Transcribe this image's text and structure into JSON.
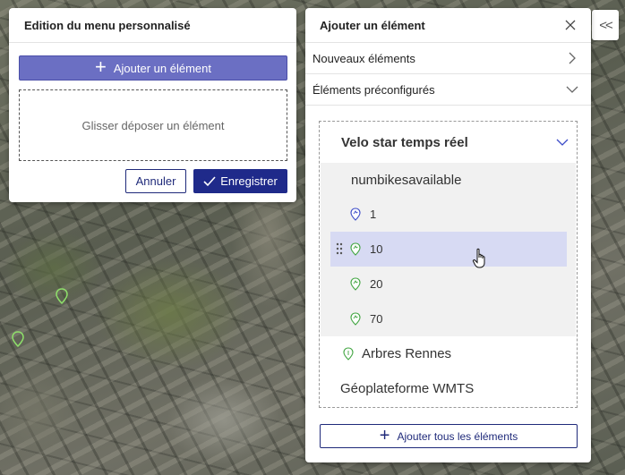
{
  "colors": {
    "accent": "#1f2a8a",
    "add_button": "#6b6fc3",
    "hover_row": "#d7daf3",
    "pin_blue": "#3b4bc8",
    "pin_green": "#3fa43f"
  },
  "collapse_button": {
    "icon": "double-chevron-left-icon",
    "label": "<<"
  },
  "edit_panel": {
    "title": "Edition du menu personnalisé",
    "add_button": "Ajouter un élément",
    "drop_zone": "Glisser déposer un élément",
    "cancel": "Annuler",
    "save": "Enregistrer"
  },
  "add_panel": {
    "title": "Ajouter un élément",
    "sections": {
      "new_elements": "Nouveaux éléments",
      "preconfigured": "Éléments préconfigurés"
    },
    "tree": {
      "group": "Velo star temps réel",
      "subgroup": "numbikesavailable",
      "items": [
        {
          "label": "1",
          "icon": "map-pin-blue-icon"
        },
        {
          "label": "10",
          "icon": "map-pin-green-icon"
        },
        {
          "label": "20",
          "icon": "map-pin-green-icon"
        },
        {
          "label": "70",
          "icon": "map-pin-green-icon"
        }
      ],
      "layer_trees": "Arbres Rennes",
      "layer_wmts": "Géoplateforme WMTS"
    },
    "add_all": "Ajouter tous les éléments"
  }
}
